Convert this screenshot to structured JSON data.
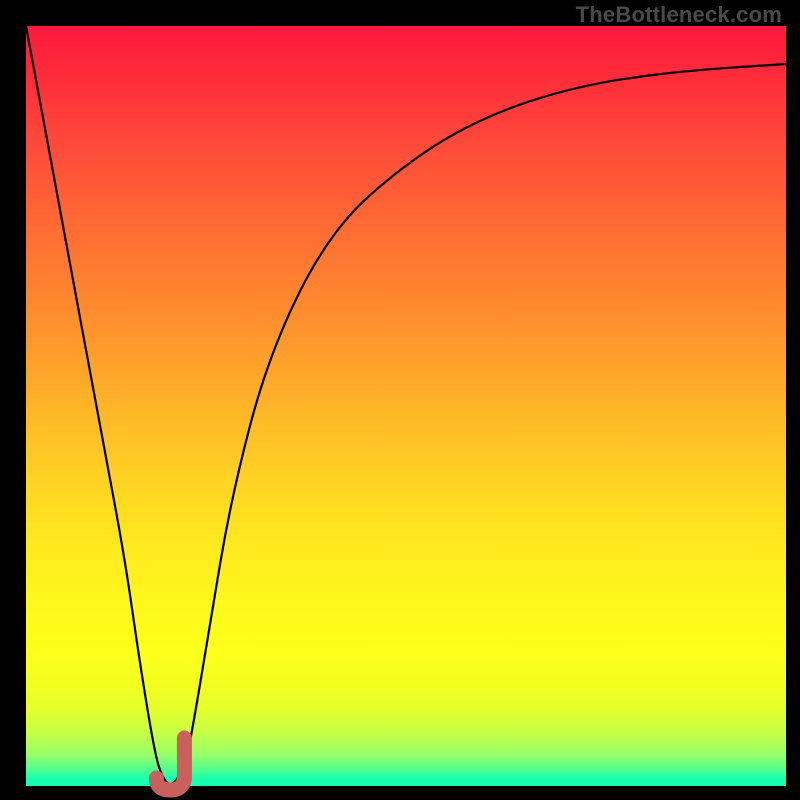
{
  "watermark": "TheBottleneck.com",
  "chart_data": {
    "type": "line",
    "title": "",
    "xlabel": "",
    "ylabel": "",
    "xlim": [
      0,
      100
    ],
    "ylim": [
      0,
      100
    ],
    "series": [
      {
        "name": "bottleneck-curve",
        "x": [
          0,
          5,
          10,
          13,
          15,
          17,
          18,
          19,
          20,
          21,
          22,
          24,
          27,
          32,
          40,
          50,
          60,
          72,
          85,
          100
        ],
        "values": [
          100,
          73,
          46,
          30,
          16,
          4,
          1,
          0,
          1,
          3,
          8,
          20,
          38,
          57,
          73,
          82,
          88,
          92,
          94,
          95
        ]
      }
    ],
    "annotations": [
      {
        "name": "min-marker",
        "x": 19,
        "y": 0,
        "shape": "J-tick",
        "color": "#c9605e"
      }
    ],
    "grid": false,
    "legend": false,
    "background": "vertical-gradient red→green"
  }
}
